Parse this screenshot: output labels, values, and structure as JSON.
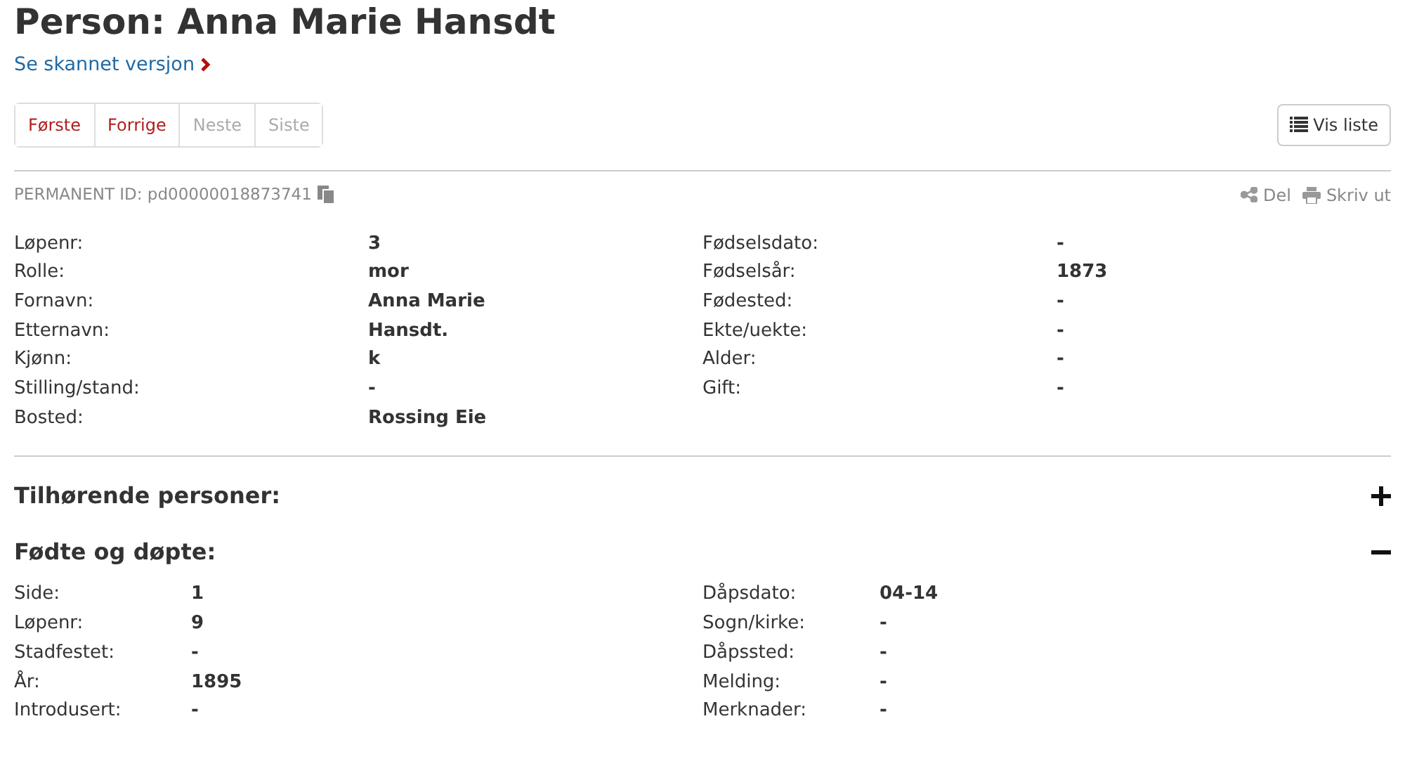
{
  "title": "Person: Anna Marie Hansdt",
  "scan_link": "Se skannet versjon",
  "pager": [
    {
      "label": "Første",
      "disabled": false
    },
    {
      "label": "Forrige",
      "disabled": false
    },
    {
      "label": "Neste",
      "disabled": true
    },
    {
      "label": "Siste",
      "disabled": true
    }
  ],
  "list_button": "Vis liste",
  "permanent_id": "PERMANENT ID: pd00000018873741",
  "actions": [
    {
      "kind": "share",
      "label": "Del"
    },
    {
      "kind": "print",
      "label": "Skriv ut"
    }
  ],
  "person_fields": {
    "left": [
      {
        "label": "Løpenr:",
        "value": "3"
      },
      {
        "label": "Rolle:",
        "value": "mor"
      },
      {
        "label": "Fornavn:",
        "value": "Anna Marie"
      },
      {
        "label": "Etternavn:",
        "value": "Hansdt."
      },
      {
        "label": "Kjønn:",
        "value": "k"
      },
      {
        "label": "Stilling/stand:",
        "value": "-"
      },
      {
        "label": "Bosted:",
        "value": "Rossing Eie"
      }
    ],
    "right": [
      {
        "label": "Fødselsdato:",
        "value": "-"
      },
      {
        "label": "Fødselsår:",
        "value": "1873"
      },
      {
        "label": "Fødested:",
        "value": "-"
      },
      {
        "label": "Ekte/uekte:",
        "value": "-"
      },
      {
        "label": "Alder:",
        "value": "-"
      },
      {
        "label": "Gift:",
        "value": "-"
      }
    ]
  },
  "sections": [
    {
      "title": "Tilhørende personer:",
      "expanded": false
    },
    {
      "title": "Fødte og døpte:",
      "expanded": true,
      "left": [
        {
          "label": "Side:",
          "value": "1"
        },
        {
          "label": "Løpenr:",
          "value": "9"
        },
        {
          "label": "Stadfestet:",
          "value": "-"
        },
        {
          "label": "År:",
          "value": "1895"
        },
        {
          "label": "Introdusert:",
          "value": "-"
        }
      ],
      "right": [
        {
          "label": "Dåpsdato:",
          "value": "04-14"
        },
        {
          "label": "Sogn/kirke:",
          "value": "-"
        },
        {
          "label": "Dåpssted:",
          "value": "-"
        },
        {
          "label": "Melding:",
          "value": "-"
        },
        {
          "label": "Merknader:",
          "value": "-"
        }
      ]
    }
  ]
}
